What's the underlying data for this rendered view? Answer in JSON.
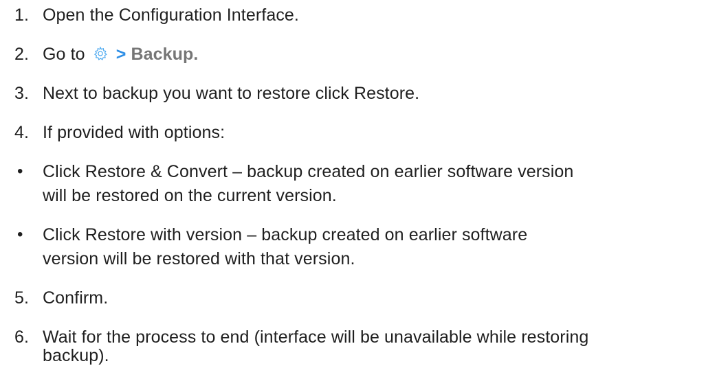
{
  "steps": [
    {
      "marker": "1.",
      "text": "Open the Configuration Interface."
    },
    {
      "marker": "2.",
      "prefix": "Go to",
      "separator": ">",
      "crumb": "Backup."
    },
    {
      "marker": "3.",
      "text": "Next to backup you want to restore click Restore."
    },
    {
      "marker": "4.",
      "text": "If provided with options:"
    },
    {
      "marker": "•",
      "line1": "Click Restore & Convert – backup created on earlier software version",
      "line2": "will be restored on the current version."
    },
    {
      "marker": "•",
      "line1": "Click Restore with version – backup created on earlier software",
      "line2": "version will be restored with that version."
    },
    {
      "marker": "5.",
      "text": "Confirm."
    },
    {
      "marker": "6.",
      "line1": "Wait for the process to end (interface will be unavailable while restoring",
      "line2": "backup)."
    }
  ],
  "icons": {
    "settings": "gear-icon"
  },
  "colors": {
    "text": "#1f1f1f",
    "separator": "#2c8ee6",
    "crumb": "#767676",
    "icon_stroke": "#4aa8f0"
  }
}
